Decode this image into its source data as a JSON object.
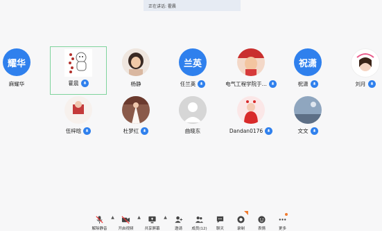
{
  "banner": {
    "speaking": "正在讲话: 霍晨"
  },
  "participants": [
    {
      "name": "麻耀华",
      "avatar_text": "耀华",
      "mic": false
    },
    {
      "name": "霍晨",
      "avatar_text": "",
      "mic": true,
      "active": true
    },
    {
      "name": "杨静",
      "avatar_text": "",
      "mic": false
    },
    {
      "name": "任兰英",
      "avatar_text": "兰英",
      "mic": true
    },
    {
      "name": "电气工程学院于...",
      "avatar_text": "",
      "mic": true
    },
    {
      "name": "祝潇",
      "avatar_text": "祝潇",
      "mic": true
    },
    {
      "name": "刘月",
      "avatar_text": "",
      "mic": true
    },
    {
      "name": "伍梓晗",
      "avatar_text": "",
      "mic": true
    },
    {
      "name": "杜梦红",
      "avatar_text": "",
      "mic": true
    },
    {
      "name": "曲晓东",
      "avatar_text": "",
      "mic": false
    },
    {
      "name": "Dandan0176",
      "avatar_text": "",
      "mic": true
    },
    {
      "name": "文文",
      "avatar_text": "",
      "mic": true
    }
  ],
  "toolbar": {
    "unmute": "解除静音",
    "video": "开启视频",
    "share": "共享屏幕",
    "invite": "邀请",
    "members": "成员(12)",
    "chat": "聊天",
    "record": "录制",
    "reactions": "表情",
    "more": "更多"
  },
  "colors": {
    "accent": "#2f80ed",
    "active_border": "#7ed39c",
    "notify": "#f07b2f"
  }
}
